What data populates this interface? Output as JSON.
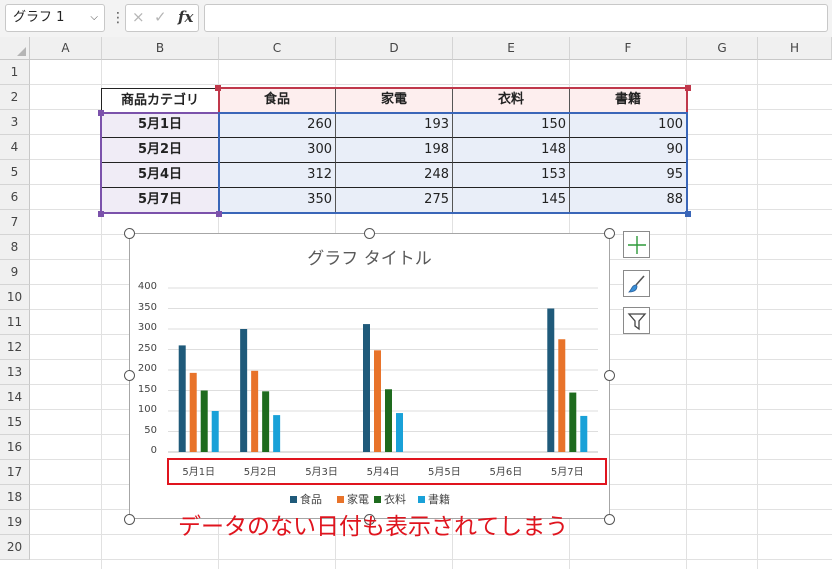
{
  "formula_bar": {
    "name_box": "グラフ 1",
    "cancel_icon": "×",
    "enter_icon": "✓",
    "fx_label": "fx",
    "formula_value": ""
  },
  "columns": [
    "A",
    "B",
    "C",
    "D",
    "E",
    "F",
    "G",
    "H"
  ],
  "rows": [
    "1",
    "2",
    "3",
    "4",
    "5",
    "6",
    "7",
    "8",
    "9",
    "10",
    "11",
    "12",
    "13",
    "14",
    "15",
    "16",
    "17",
    "18",
    "19",
    "20"
  ],
  "table": {
    "header": [
      "商品カテゴリ",
      "食品",
      "家電",
      "衣料",
      "書籍"
    ],
    "rows": [
      {
        "date": "5月1日",
        "values": [
          "260",
          "193",
          "150",
          "100"
        ]
      },
      {
        "date": "5月2日",
        "values": [
          "300",
          "198",
          "148",
          "90"
        ]
      },
      {
        "date": "5月4日",
        "values": [
          "312",
          "248",
          "153",
          "95"
        ]
      },
      {
        "date": "5月7日",
        "values": [
          "350",
          "275",
          "145",
          "88"
        ]
      }
    ]
  },
  "chart_data": {
    "type": "bar",
    "title": "グラフ タイトル",
    "categories": [
      "5月1日",
      "5月2日",
      "5月3日",
      "5月4日",
      "5月5日",
      "5月6日",
      "5月7日"
    ],
    "series": [
      {
        "name": "食品",
        "color": "#1f5a7a",
        "values": [
          260,
          300,
          null,
          312,
          null,
          null,
          350
        ]
      },
      {
        "name": "家電",
        "color": "#e8732a",
        "values": [
          193,
          198,
          null,
          248,
          null,
          null,
          275
        ]
      },
      {
        "name": "衣料",
        "color": "#1e6b1e",
        "values": [
          150,
          148,
          null,
          153,
          null,
          null,
          145
        ]
      },
      {
        "name": "書籍",
        "color": "#19a1d8",
        "values": [
          100,
          90,
          null,
          95,
          null,
          null,
          88
        ]
      }
    ],
    "ylim": [
      0,
      400
    ],
    "yticks": [
      "400",
      "350",
      "300",
      "250",
      "200",
      "150",
      "100",
      "50",
      "0"
    ],
    "grid": true,
    "legend": "bottom"
  },
  "annotation": "データのない日付も表示されてしまう",
  "chart_tools": [
    "chart-elements-icon",
    "chart-styles-icon",
    "chart-filters-icon"
  ]
}
